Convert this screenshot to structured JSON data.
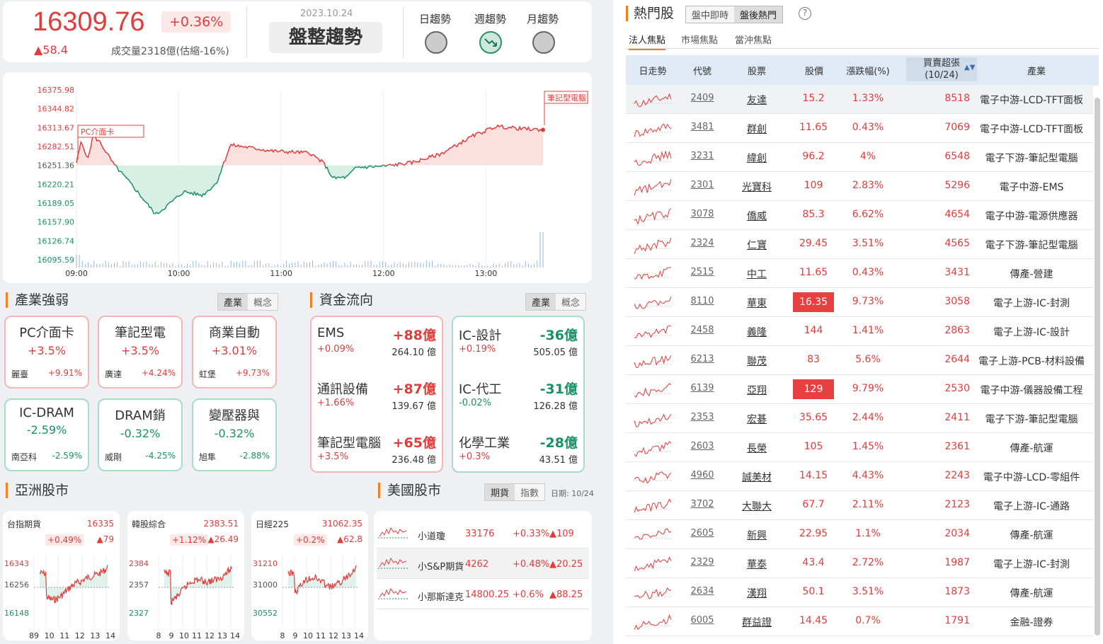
{
  "index": {
    "value": "16309.76",
    "pct": "+0.36%",
    "change": "▲58.4",
    "volume": "成交量2318億(估縮-16%)",
    "date": "2023.10.24",
    "trend": "盤整趨勢"
  },
  "trend_labels": [
    "日趨勢",
    "週趨勢",
    "月趨勢"
  ],
  "chart": {
    "y_ticks": [
      "16375.98",
      "16344.82",
      "16313.67",
      "16282.51",
      "16251.36",
      "16220.21",
      "16189.05",
      "16157.90",
      "16126.74",
      "16095.59"
    ],
    "x_ticks": [
      "09:00",
      "10:00",
      "11:00",
      "12:00",
      "13:00"
    ],
    "annotations": [
      "PC介面卡",
      "筆記型電腦"
    ],
    "ylim": [
      16095.59,
      16375.98
    ],
    "reference": 16251.36
  },
  "sections": {
    "industry": "產業強弱",
    "fundflow": "資金流向",
    "asia": "亞洲股市",
    "us": "美國股市"
  },
  "seg": {
    "a": "產業",
    "b": "概念"
  },
  "us_seg": {
    "a": "期貨",
    "b": "指數",
    "date": "日期: 10/24"
  },
  "industries": [
    {
      "name": "PC介面卡",
      "pct": "+3.5%",
      "stock": "麗臺",
      "spct": "+9.91%",
      "dir": "up"
    },
    {
      "name": "筆記型電",
      "pct": "+3.5%",
      "stock": "廣達",
      "spct": "+4.24%",
      "dir": "up"
    },
    {
      "name": "商業自動",
      "pct": "+3.01%",
      "stock": "虹堡",
      "spct": "+9.73%",
      "dir": "up"
    },
    {
      "name": "IC-DRAM",
      "pct": "-2.59%",
      "stock": "南亞科",
      "spct": "-2.59%",
      "dir": "dn"
    },
    {
      "name": "DRAM銷",
      "pct": "-0.32%",
      "stock": "威剛",
      "spct": "-4.25%",
      "dir": "dn"
    },
    {
      "name": "變壓器與",
      "pct": "-0.32%",
      "stock": "旭隼",
      "spct": "-2.88%",
      "dir": "dn"
    }
  ],
  "fund_in": [
    {
      "name": "EMS",
      "amt": "+88億",
      "pct": "+0.09%",
      "vol": "264.10 億"
    },
    {
      "name": "通訊設備",
      "amt": "+87億",
      "pct": "+1.66%",
      "vol": "139.67 億"
    },
    {
      "name": "筆記型電腦",
      "amt": "+65億",
      "pct": "+3.5%",
      "vol": "236.48 億"
    }
  ],
  "fund_out": [
    {
      "name": "IC-設計",
      "amt": "-36億",
      "pct": "+0.19%",
      "vol": "505.05 億"
    },
    {
      "name": "IC-代工",
      "amt": "-31億",
      "pct": "-0.02%",
      "vol": "126.28 億"
    },
    {
      "name": "化學工業",
      "amt": "-28億",
      "pct": "+0.3%",
      "vol": "43.51 億"
    }
  ],
  "asia": [
    {
      "name": "台指期貨",
      "price": "16335",
      "pct": "+0.49%",
      "chg": "▲79",
      "y": [
        "16343",
        "16256",
        "16148"
      ],
      "x": [
        "89",
        "10",
        "11",
        "12",
        "13",
        "14"
      ]
    },
    {
      "name": "韓股綜合",
      "price": "2383.51",
      "pct": "+1.12%",
      "chg": "▲26.49",
      "y": [
        "2384",
        "2357",
        "2327"
      ],
      "x": [
        "8",
        "9",
        "10",
        "11",
        "12",
        "13",
        "14"
      ]
    },
    {
      "name": "日經225",
      "price": "31062.35",
      "pct": "+0.2%",
      "chg": "▲62.8",
      "y": [
        "31210",
        "31000",
        "30552"
      ],
      "x": [
        "8",
        "9",
        "10",
        "11",
        "12",
        "13",
        "14"
      ]
    }
  ],
  "us": [
    {
      "name": "小道瓊",
      "price": "33176",
      "pct": "+0.33%",
      "chg": "▲109"
    },
    {
      "name": "小S&P期貨",
      "price": "4262",
      "pct": "+0.48%",
      "chg": "▲20.25"
    },
    {
      "name": "小那斯達克",
      "price": "14800.25",
      "pct": "+0.6%",
      "chg": "▲88.25"
    }
  ],
  "hot": {
    "title": "熱門股",
    "seg": [
      "盤中即時",
      "盤後熱門"
    ],
    "help": "?",
    "tabs": [
      "法人焦點",
      "市場焦點",
      "當沖焦點"
    ],
    "headers": [
      "日走勢",
      "代號",
      "股票",
      "股價",
      "漲跌幅(%)",
      "買賣超張",
      "(10/24)",
      "產業"
    ],
    "sort_icon": "▲▼",
    "rows": [
      {
        "code": "2409",
        "name": "友達",
        "price": "15.2",
        "pct": "1.33%",
        "bs": "8518",
        "ind": "電子中游-LCD-TFT面板"
      },
      {
        "code": "3481",
        "name": "群創",
        "price": "11.65",
        "pct": "0.43%",
        "bs": "7069",
        "ind": "電子中游-LCD-TFT面板"
      },
      {
        "code": "3231",
        "name": "緯創",
        "price": "96.2",
        "pct": "4%",
        "bs": "6548",
        "ind": "電子下游-筆記型電腦"
      },
      {
        "code": "2301",
        "name": "光寶科",
        "price": "109",
        "pct": "2.83%",
        "bs": "5296",
        "ind": "電子中游-EMS"
      },
      {
        "code": "3078",
        "name": "僑威",
        "price": "85.3",
        "pct": "6.62%",
        "bs": "4654",
        "ind": "電子中游-電源供應器"
      },
      {
        "code": "2324",
        "name": "仁寶",
        "price": "29.45",
        "pct": "3.51%",
        "bs": "4565",
        "ind": "電子下游-筆記型電腦"
      },
      {
        "code": "2515",
        "name": "中工",
        "price": "11.65",
        "pct": "0.43%",
        "bs": "3431",
        "ind": "傳產-營建"
      },
      {
        "code": "8110",
        "name": "華東",
        "price": "16.35",
        "pct": "9.73%",
        "bs": "3058",
        "ind": "電子上游-IC-封測",
        "lim": true
      },
      {
        "code": "2458",
        "name": "義隆",
        "price": "144",
        "pct": "1.41%",
        "bs": "2863",
        "ind": "電子上游-IC-設計"
      },
      {
        "code": "6213",
        "name": "聯茂",
        "price": "83",
        "pct": "5.6%",
        "bs": "2644",
        "ind": "電子上游-PCB-材料設備"
      },
      {
        "code": "6139",
        "name": "亞翔",
        "price": "129",
        "pct": "9.79%",
        "bs": "2530",
        "ind": "電子中游-儀器設備工程",
        "lim": true
      },
      {
        "code": "2353",
        "name": "宏碁",
        "price": "35.65",
        "pct": "2.44%",
        "bs": "2411",
        "ind": "電子下游-筆記型電腦"
      },
      {
        "code": "2603",
        "name": "長榮",
        "price": "105",
        "pct": "1.45%",
        "bs": "2361",
        "ind": "傳產-航運"
      },
      {
        "code": "4960",
        "name": "誠美材",
        "price": "14.15",
        "pct": "4.43%",
        "bs": "2243",
        "ind": "電子中游-LCD-零組件"
      },
      {
        "code": "3702",
        "name": "大聯大",
        "price": "67.7",
        "pct": "2.11%",
        "bs": "2123",
        "ind": "電子上游-IC-通路"
      },
      {
        "code": "2605",
        "name": "新興",
        "price": "22.95",
        "pct": "1.1%",
        "bs": "2034",
        "ind": "傳產-航運"
      },
      {
        "code": "2329",
        "name": "華泰",
        "price": "43.4",
        "pct": "2.72%",
        "bs": "1987",
        "ind": "電子上游-IC-封測"
      },
      {
        "code": "2634",
        "name": "漢翔",
        "price": "50.1",
        "pct": "3.51%",
        "bs": "1873",
        "ind": "傳產-航運"
      },
      {
        "code": "6005",
        "name": "群益證",
        "price": "14.45",
        "pct": "0.7%",
        "bs": "1791",
        "ind": "金融-證券"
      }
    ]
  }
}
